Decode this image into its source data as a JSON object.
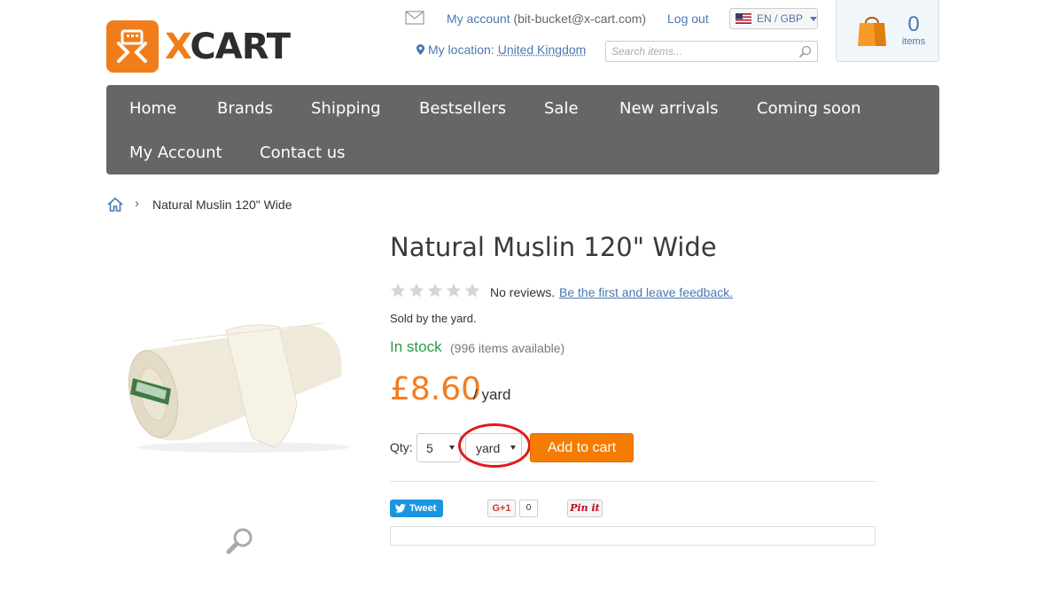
{
  "logo": {
    "x_letter": "X",
    "rest": "CART"
  },
  "header": {
    "account_label": "My account",
    "account_email": "(bit-bucket@x-cart.com)",
    "logout_label": "Log out",
    "language": "EN / GBP",
    "location_label": "My location:",
    "location_value": "United Kingdom",
    "search_placeholder": "Search items..."
  },
  "cart": {
    "count": "0",
    "label": "items"
  },
  "nav": {
    "items": [
      {
        "label": "Home"
      },
      {
        "label": "Brands"
      },
      {
        "label": "Shipping"
      },
      {
        "label": "Bestsellers"
      },
      {
        "label": "Sale"
      },
      {
        "label": "New arrivals"
      },
      {
        "label": "Coming soon"
      },
      {
        "label": "My Account"
      },
      {
        "label": "Contact us"
      }
    ]
  },
  "breadcrumb": {
    "separator": "›",
    "current": "Natural Muslin 120\" Wide"
  },
  "product": {
    "title": "Natural Muslin 120\" Wide",
    "rating": 0,
    "no_reviews": "No reviews.",
    "feedback_link": "Be the first and leave feedback.",
    "sold_by": "Sold by the yard.",
    "stock_status": "In stock",
    "available": "(996 items available)",
    "price": "£8.60",
    "price_unit": "/ yard",
    "qty_label": "Qty:",
    "qty_value": "5",
    "unit_value": "yard",
    "add_to_cart": "Add to cart"
  },
  "social": {
    "tweet": "Tweet",
    "gplus": "G+1",
    "gplus_count": "0",
    "pinit": "Pin it"
  },
  "colors": {
    "accent": "#f57c00",
    "nav_bg": "#666666",
    "link": "#4a78b0",
    "in_stock": "#2a9a45",
    "highlight": "#e11a1a"
  }
}
